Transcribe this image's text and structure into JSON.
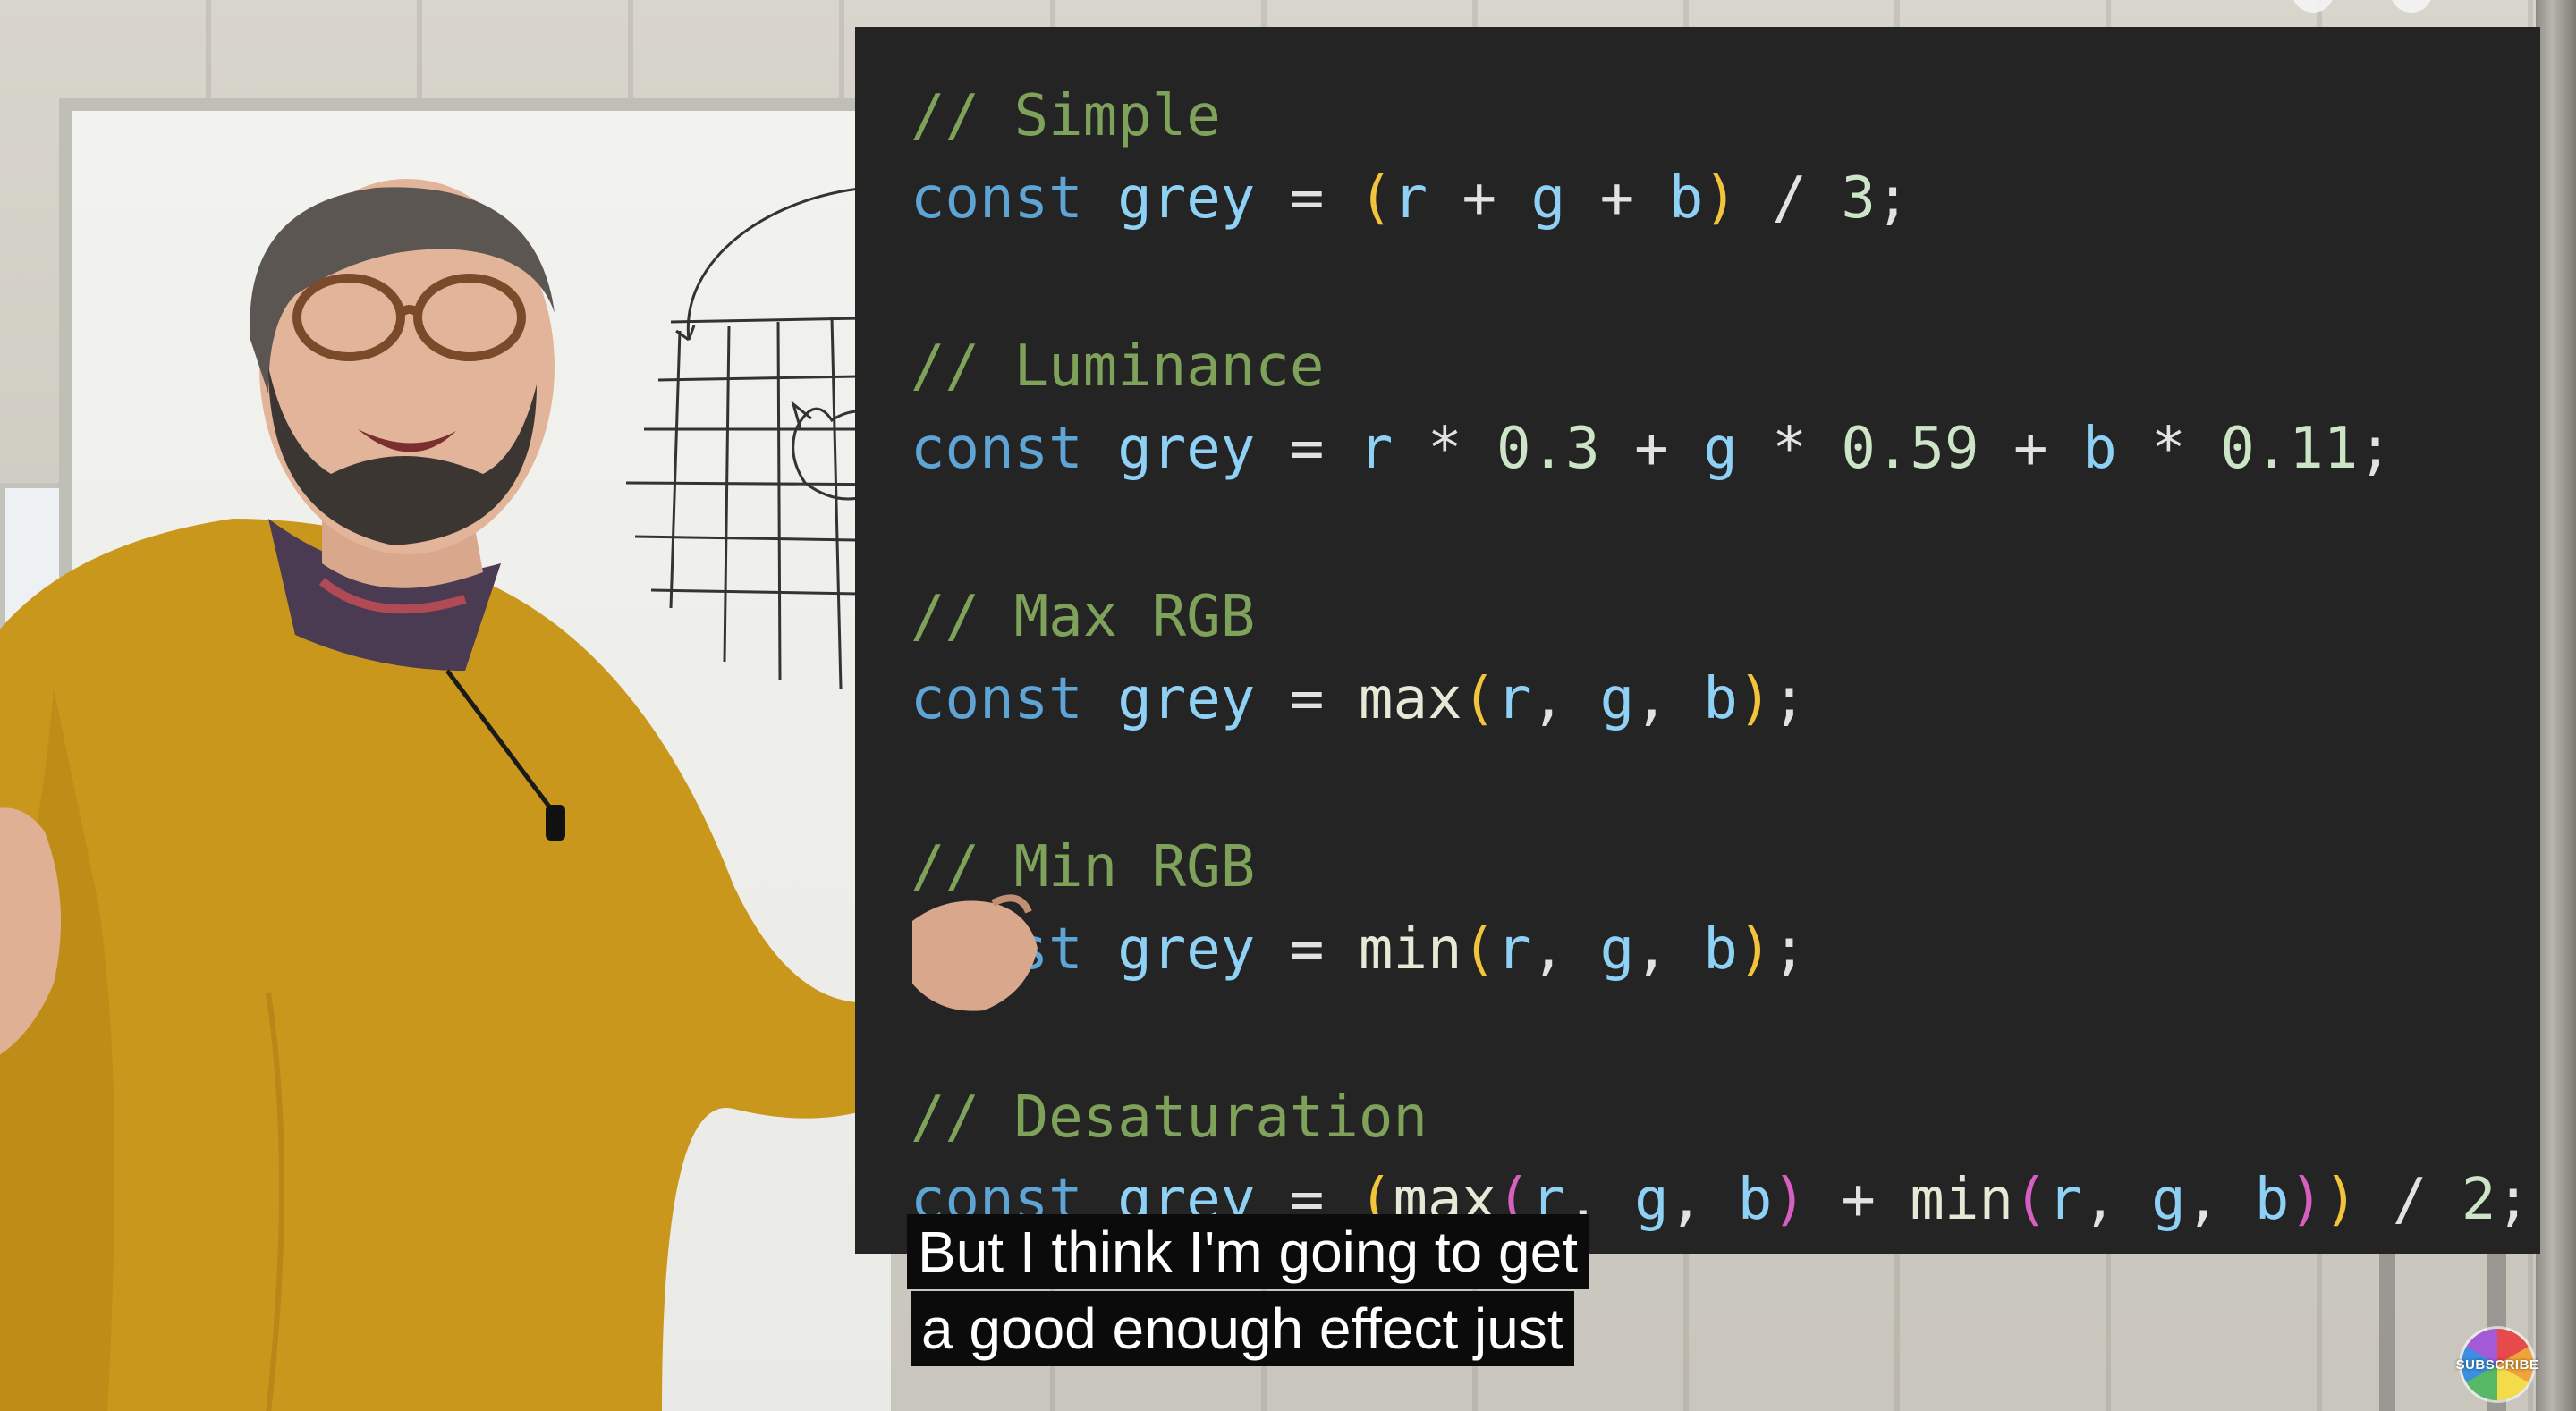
{
  "code": {
    "lines": [
      [
        {
          "t": "// Simple",
          "c": "cm"
        }
      ],
      [
        {
          "t": "const",
          "c": "kw"
        },
        {
          "t": " ",
          "c": "op"
        },
        {
          "t": "grey",
          "c": "vr"
        },
        {
          "t": " = ",
          "c": "op"
        },
        {
          "t": "(",
          "c": "p1"
        },
        {
          "t": "r",
          "c": "vr"
        },
        {
          "t": " + ",
          "c": "op"
        },
        {
          "t": "g",
          "c": "vr"
        },
        {
          "t": " + ",
          "c": "op"
        },
        {
          "t": "b",
          "c": "vr"
        },
        {
          "t": ")",
          "c": "p1"
        },
        {
          "t": " / ",
          "c": "op"
        },
        {
          "t": "3",
          "c": "nm"
        },
        {
          "t": ";",
          "c": "op"
        }
      ],
      [
        {
          "t": "// Luminance",
          "c": "cm"
        }
      ],
      [
        {
          "t": "const",
          "c": "kw"
        },
        {
          "t": " ",
          "c": "op"
        },
        {
          "t": "grey",
          "c": "vr"
        },
        {
          "t": " = ",
          "c": "op"
        },
        {
          "t": "r",
          "c": "vr"
        },
        {
          "t": " * ",
          "c": "op"
        },
        {
          "t": "0.3",
          "c": "nm"
        },
        {
          "t": " + ",
          "c": "op"
        },
        {
          "t": "g",
          "c": "vr"
        },
        {
          "t": " * ",
          "c": "op"
        },
        {
          "t": "0.59",
          "c": "nm"
        },
        {
          "t": " + ",
          "c": "op"
        },
        {
          "t": "b",
          "c": "vr"
        },
        {
          "t": " * ",
          "c": "op"
        },
        {
          "t": "0.11",
          "c": "nm"
        },
        {
          "t": ";",
          "c": "op"
        }
      ],
      [
        {
          "t": "// Max RGB",
          "c": "cm"
        }
      ],
      [
        {
          "t": "const",
          "c": "kw"
        },
        {
          "t": " ",
          "c": "op"
        },
        {
          "t": "grey",
          "c": "vr"
        },
        {
          "t": " = ",
          "c": "op"
        },
        {
          "t": "max",
          "c": "fn"
        },
        {
          "t": "(",
          "c": "p1"
        },
        {
          "t": "r",
          "c": "vr"
        },
        {
          "t": ", ",
          "c": "op"
        },
        {
          "t": "g",
          "c": "vr"
        },
        {
          "t": ", ",
          "c": "op"
        },
        {
          "t": "b",
          "c": "vr"
        },
        {
          "t": ")",
          "c": "p1"
        },
        {
          "t": ";",
          "c": "op"
        }
      ],
      [
        {
          "t": "// Min RGB",
          "c": "cm"
        }
      ],
      [
        {
          "t": "const",
          "c": "kw"
        },
        {
          "t": " ",
          "c": "op"
        },
        {
          "t": "grey",
          "c": "vr"
        },
        {
          "t": " = ",
          "c": "op"
        },
        {
          "t": "min",
          "c": "fn"
        },
        {
          "t": "(",
          "c": "p1"
        },
        {
          "t": "r",
          "c": "vr"
        },
        {
          "t": ", ",
          "c": "op"
        },
        {
          "t": "g",
          "c": "vr"
        },
        {
          "t": ", ",
          "c": "op"
        },
        {
          "t": "b",
          "c": "vr"
        },
        {
          "t": ")",
          "c": "p1"
        },
        {
          "t": ";",
          "c": "op"
        }
      ],
      [
        {
          "t": "// Desaturation",
          "c": "cm"
        }
      ],
      [
        {
          "t": "const",
          "c": "kw"
        },
        {
          "t": " ",
          "c": "op"
        },
        {
          "t": "grey",
          "c": "vr"
        },
        {
          "t": " = ",
          "c": "op"
        },
        {
          "t": "(",
          "c": "p1"
        },
        {
          "t": "max",
          "c": "fn"
        },
        {
          "t": "(",
          "c": "p2"
        },
        {
          "t": "r",
          "c": "vr"
        },
        {
          "t": ", ",
          "c": "op"
        },
        {
          "t": "g",
          "c": "vr"
        },
        {
          "t": ", ",
          "c": "op"
        },
        {
          "t": "b",
          "c": "vr"
        },
        {
          "t": ")",
          "c": "p2"
        },
        {
          "t": " + ",
          "c": "op"
        },
        {
          "t": "min",
          "c": "fn"
        },
        {
          "t": "(",
          "c": "p2"
        },
        {
          "t": "r",
          "c": "vr"
        },
        {
          "t": ", ",
          "c": "op"
        },
        {
          "t": "g",
          "c": "vr"
        },
        {
          "t": ", ",
          "c": "op"
        },
        {
          "t": "b",
          "c": "vr"
        },
        {
          "t": ")",
          "c": "p2"
        },
        {
          "t": ")",
          "c": "p1"
        },
        {
          "t": " / ",
          "c": "op"
        },
        {
          "t": "2",
          "c": "nm"
        },
        {
          "t": ";",
          "c": "op"
        }
      ]
    ]
  },
  "captions": {
    "line1": "But I think I'm going to get",
    "line2": "a good enough effect just"
  },
  "overlay": {
    "subscribe_label": "SUBSCRIBE"
  },
  "colors": {
    "code_background": "#242424",
    "comment": "#7ea25a",
    "keyword": "#5ea5d6",
    "variable": "#8fd0f5",
    "number": "#cde5c7",
    "paren_outer": "#f2c33b",
    "paren_inner": "#d65fc1",
    "sweater": "#c9971c"
  }
}
